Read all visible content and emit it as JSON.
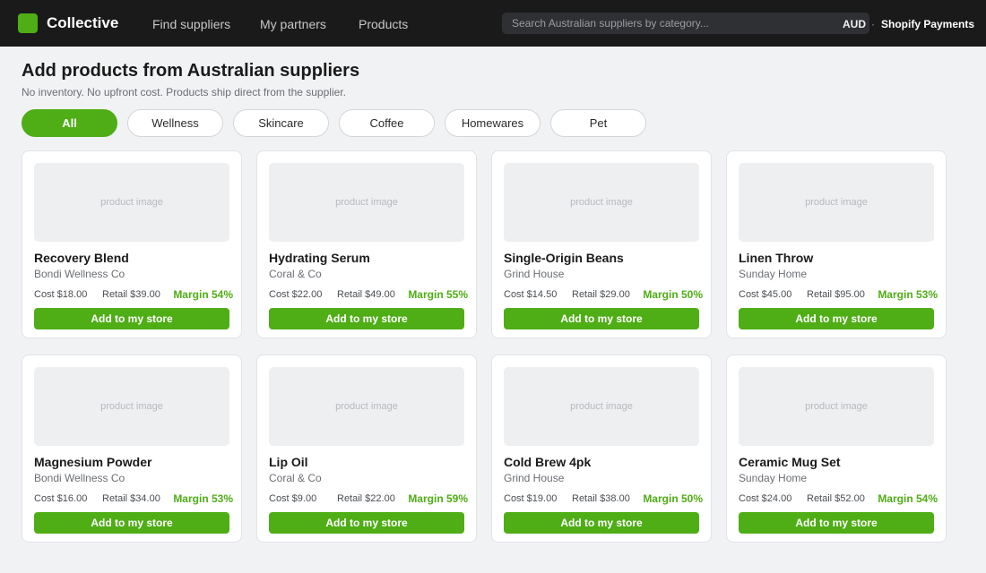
{
  "header": {
    "brand": "Collective",
    "nav": [
      {
        "label": "Find suppliers"
      },
      {
        "label": "My partners"
      },
      {
        "label": "Products"
      }
    ],
    "search_placeholder": "Search Australian suppliers by category...",
    "currency": "AUD",
    "separator": "·",
    "payments_label": "Shopify Payments"
  },
  "page": {
    "title": "Add products from Australian suppliers",
    "subtitle": "No inventory. No upfront cost. Products ship direct from the supplier."
  },
  "filters": [
    "All",
    "Wellness",
    "Skincare",
    "Coffee",
    "Homewares",
    "Pet"
  ],
  "active_filter": "All",
  "products": [
    {
      "image_label": "product image",
      "name": "Recovery Blend",
      "supplier": "Bondi Wellness Co",
      "cost": "Cost $18.00",
      "retail": "Retail $39.00",
      "margin": "Margin 54%",
      "cta": "Add to my store"
    },
    {
      "image_label": "product image",
      "name": "Hydrating Serum",
      "supplier": "Coral & Co",
      "cost": "Cost $22.00",
      "retail": "Retail $49.00",
      "margin": "Margin 55%",
      "cta": "Add to my store"
    },
    {
      "image_label": "product image",
      "name": "Single-Origin Beans",
      "supplier": "Grind House",
      "cost": "Cost $14.50",
      "retail": "Retail $29.00",
      "margin": "Margin 50%",
      "cta": "Add to my store"
    },
    {
      "image_label": "product image",
      "name": "Linen Throw",
      "supplier": "Sunday Home",
      "cost": "Cost $45.00",
      "retail": "Retail $95.00",
      "margin": "Margin 53%",
      "cta": "Add to my store"
    },
    {
      "image_label": "product image",
      "name": "Magnesium Powder",
      "supplier": "Bondi Wellness Co",
      "cost": "Cost $16.00",
      "retail": "Retail $34.00",
      "margin": "Margin 53%",
      "cta": "Add to my store"
    },
    {
      "image_label": "product image",
      "name": "Lip Oil",
      "supplier": "Coral & Co",
      "cost": "Cost $9.00",
      "retail": "Retail $22.00",
      "margin": "Margin 59%",
      "cta": "Add to my store"
    },
    {
      "image_label": "product image",
      "name": "Cold Brew 4pk",
      "supplier": "Grind House",
      "cost": "Cost $19.00",
      "retail": "Retail $38.00",
      "margin": "Margin 50%",
      "cta": "Add to my store"
    },
    {
      "image_label": "product image",
      "name": "Ceramic Mug Set",
      "supplier": "Sunday Home",
      "cost": "Cost $24.00",
      "retail": "Retail $52.00",
      "margin": "Margin 54%",
      "cta": "Add to my store"
    }
  ],
  "colors": {
    "accent": "#4fad16",
    "topbar": "#1a1a1a",
    "page_background": "#f1f2f4"
  }
}
